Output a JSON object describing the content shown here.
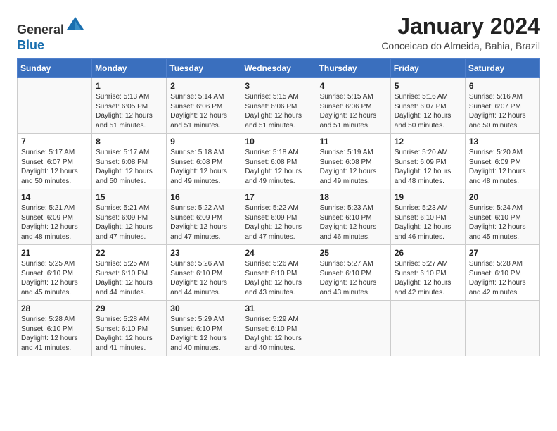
{
  "header": {
    "logo_line1": "General",
    "logo_line2": "Blue",
    "title": "January 2024",
    "subtitle": "Conceicao do Almeida, Bahia, Brazil"
  },
  "calendar": {
    "days_of_week": [
      "Sunday",
      "Monday",
      "Tuesday",
      "Wednesday",
      "Thursday",
      "Friday",
      "Saturday"
    ],
    "weeks": [
      [
        {
          "day": "",
          "info": ""
        },
        {
          "day": "1",
          "info": "Sunrise: 5:13 AM\nSunset: 6:05 PM\nDaylight: 12 hours\nand 51 minutes."
        },
        {
          "day": "2",
          "info": "Sunrise: 5:14 AM\nSunset: 6:06 PM\nDaylight: 12 hours\nand 51 minutes."
        },
        {
          "day": "3",
          "info": "Sunrise: 5:15 AM\nSunset: 6:06 PM\nDaylight: 12 hours\nand 51 minutes."
        },
        {
          "day": "4",
          "info": "Sunrise: 5:15 AM\nSunset: 6:06 PM\nDaylight: 12 hours\nand 51 minutes."
        },
        {
          "day": "5",
          "info": "Sunrise: 5:16 AM\nSunset: 6:07 PM\nDaylight: 12 hours\nand 50 minutes."
        },
        {
          "day": "6",
          "info": "Sunrise: 5:16 AM\nSunset: 6:07 PM\nDaylight: 12 hours\nand 50 minutes."
        }
      ],
      [
        {
          "day": "7",
          "info": "Sunrise: 5:17 AM\nSunset: 6:07 PM\nDaylight: 12 hours\nand 50 minutes."
        },
        {
          "day": "8",
          "info": "Sunrise: 5:17 AM\nSunset: 6:08 PM\nDaylight: 12 hours\nand 50 minutes."
        },
        {
          "day": "9",
          "info": "Sunrise: 5:18 AM\nSunset: 6:08 PM\nDaylight: 12 hours\nand 49 minutes."
        },
        {
          "day": "10",
          "info": "Sunrise: 5:18 AM\nSunset: 6:08 PM\nDaylight: 12 hours\nand 49 minutes."
        },
        {
          "day": "11",
          "info": "Sunrise: 5:19 AM\nSunset: 6:08 PM\nDaylight: 12 hours\nand 49 minutes."
        },
        {
          "day": "12",
          "info": "Sunrise: 5:20 AM\nSunset: 6:09 PM\nDaylight: 12 hours\nand 48 minutes."
        },
        {
          "day": "13",
          "info": "Sunrise: 5:20 AM\nSunset: 6:09 PM\nDaylight: 12 hours\nand 48 minutes."
        }
      ],
      [
        {
          "day": "14",
          "info": "Sunrise: 5:21 AM\nSunset: 6:09 PM\nDaylight: 12 hours\nand 48 minutes."
        },
        {
          "day": "15",
          "info": "Sunrise: 5:21 AM\nSunset: 6:09 PM\nDaylight: 12 hours\nand 47 minutes."
        },
        {
          "day": "16",
          "info": "Sunrise: 5:22 AM\nSunset: 6:09 PM\nDaylight: 12 hours\nand 47 minutes."
        },
        {
          "day": "17",
          "info": "Sunrise: 5:22 AM\nSunset: 6:09 PM\nDaylight: 12 hours\nand 47 minutes."
        },
        {
          "day": "18",
          "info": "Sunrise: 5:23 AM\nSunset: 6:10 PM\nDaylight: 12 hours\nand 46 minutes."
        },
        {
          "day": "19",
          "info": "Sunrise: 5:23 AM\nSunset: 6:10 PM\nDaylight: 12 hours\nand 46 minutes."
        },
        {
          "day": "20",
          "info": "Sunrise: 5:24 AM\nSunset: 6:10 PM\nDaylight: 12 hours\nand 45 minutes."
        }
      ],
      [
        {
          "day": "21",
          "info": "Sunrise: 5:25 AM\nSunset: 6:10 PM\nDaylight: 12 hours\nand 45 minutes."
        },
        {
          "day": "22",
          "info": "Sunrise: 5:25 AM\nSunset: 6:10 PM\nDaylight: 12 hours\nand 44 minutes."
        },
        {
          "day": "23",
          "info": "Sunrise: 5:26 AM\nSunset: 6:10 PM\nDaylight: 12 hours\nand 44 minutes."
        },
        {
          "day": "24",
          "info": "Sunrise: 5:26 AM\nSunset: 6:10 PM\nDaylight: 12 hours\nand 43 minutes."
        },
        {
          "day": "25",
          "info": "Sunrise: 5:27 AM\nSunset: 6:10 PM\nDaylight: 12 hours\nand 43 minutes."
        },
        {
          "day": "26",
          "info": "Sunrise: 5:27 AM\nSunset: 6:10 PM\nDaylight: 12 hours\nand 42 minutes."
        },
        {
          "day": "27",
          "info": "Sunrise: 5:28 AM\nSunset: 6:10 PM\nDaylight: 12 hours\nand 42 minutes."
        }
      ],
      [
        {
          "day": "28",
          "info": "Sunrise: 5:28 AM\nSunset: 6:10 PM\nDaylight: 12 hours\nand 41 minutes."
        },
        {
          "day": "29",
          "info": "Sunrise: 5:28 AM\nSunset: 6:10 PM\nDaylight: 12 hours\nand 41 minutes."
        },
        {
          "day": "30",
          "info": "Sunrise: 5:29 AM\nSunset: 6:10 PM\nDaylight: 12 hours\nand 40 minutes."
        },
        {
          "day": "31",
          "info": "Sunrise: 5:29 AM\nSunset: 6:10 PM\nDaylight: 12 hours\nand 40 minutes."
        },
        {
          "day": "",
          "info": ""
        },
        {
          "day": "",
          "info": ""
        },
        {
          "day": "",
          "info": ""
        }
      ]
    ]
  }
}
